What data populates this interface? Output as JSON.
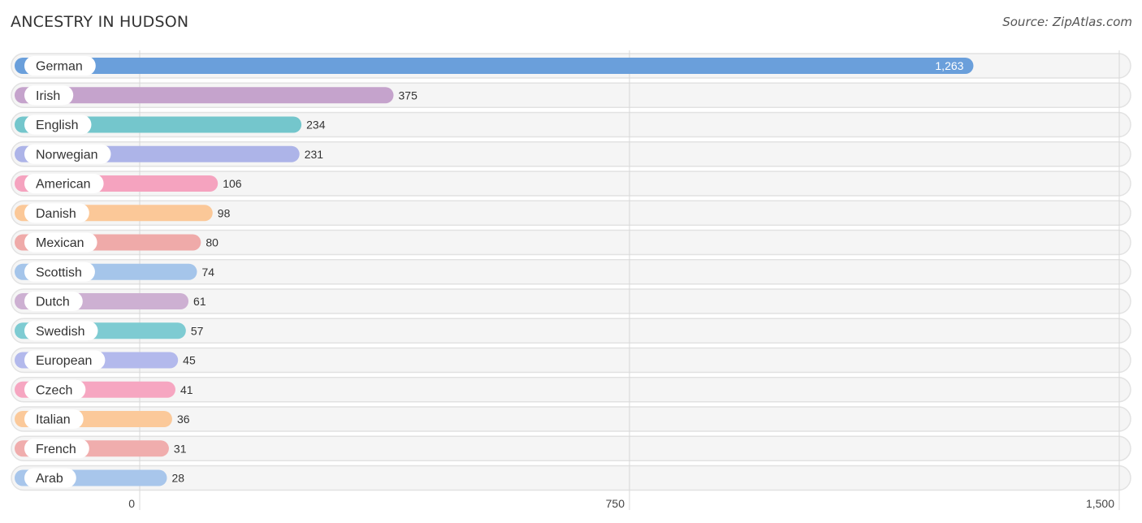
{
  "chart_data": {
    "type": "bar",
    "orientation": "horizontal",
    "title": "ANCESTRY IN HUDSON",
    "source": "Source: ZipAtlas.com",
    "xlabel": "",
    "ylabel": "",
    "xlim": [
      0,
      1500
    ],
    "ticks": [
      0,
      750,
      1500
    ],
    "tick_labels": [
      "0",
      "750",
      "1,500"
    ],
    "grid": true,
    "categories": [
      "German",
      "Irish",
      "English",
      "Norwegian",
      "American",
      "Danish",
      "Mexican",
      "Scottish",
      "Dutch",
      "Swedish",
      "European",
      "Czech",
      "Italian",
      "French",
      "Arab"
    ],
    "values": [
      1263,
      375,
      234,
      231,
      106,
      98,
      80,
      74,
      61,
      57,
      45,
      41,
      36,
      31,
      28
    ],
    "value_labels": [
      "1,263",
      "375",
      "234",
      "231",
      "106",
      "98",
      "80",
      "74",
      "61",
      "57",
      "45",
      "41",
      "36",
      "31",
      "28"
    ],
    "colors": [
      "#6a9fdb",
      "#c5a3cc",
      "#74c6cc",
      "#adb4e8",
      "#f5a3bf",
      "#fbc898",
      "#efaaa9",
      "#a5c5ea",
      "#cdb0d2",
      "#7ecbd2",
      "#b3b9ec",
      "#f6a6c1",
      "#fbc99a",
      "#f0adad",
      "#a8c6eb"
    ]
  }
}
